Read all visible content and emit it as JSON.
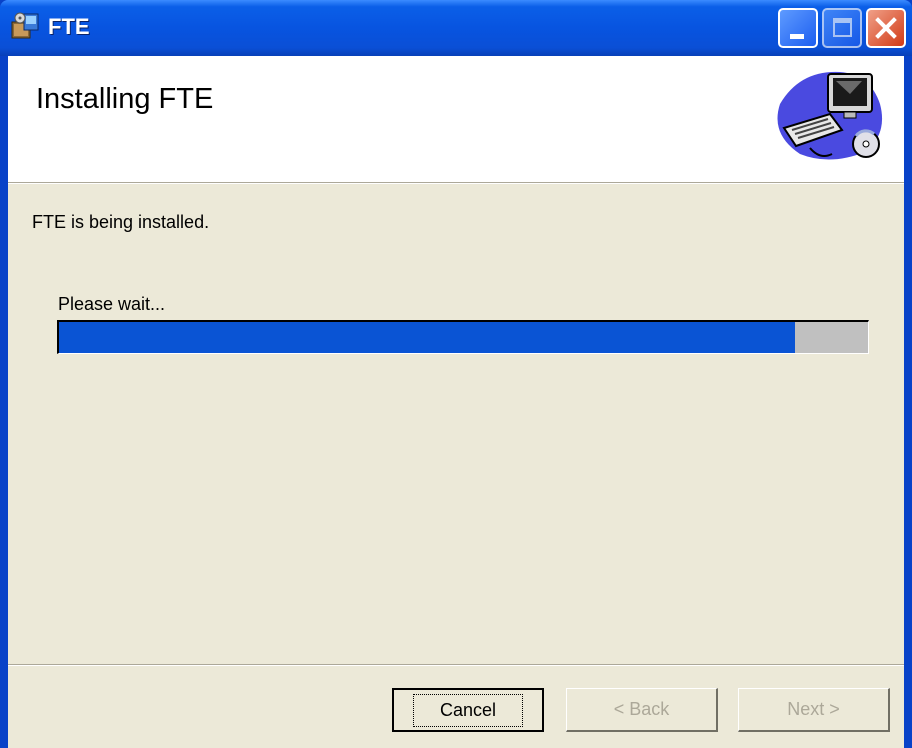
{
  "window": {
    "title": "FTE",
    "icon": "installer-icon",
    "controls": {
      "minimize_icon": "minimize-icon",
      "maximize_icon": "maximize-icon",
      "close_icon": "close-icon"
    }
  },
  "header": {
    "title": "Installing FTE",
    "art": "computer-cd-illustration"
  },
  "body": {
    "status_text": "FTE is being installed.",
    "wait_text": "Please wait...",
    "progress_fraction": 0.91
  },
  "buttons": {
    "cancel": "Cancel",
    "back": "< Back",
    "next": "Next >"
  },
  "colors": {
    "titlebar": "#0854e0",
    "progress_fill": "#0a54d4",
    "dialog_bg": "#ece9d8"
  }
}
